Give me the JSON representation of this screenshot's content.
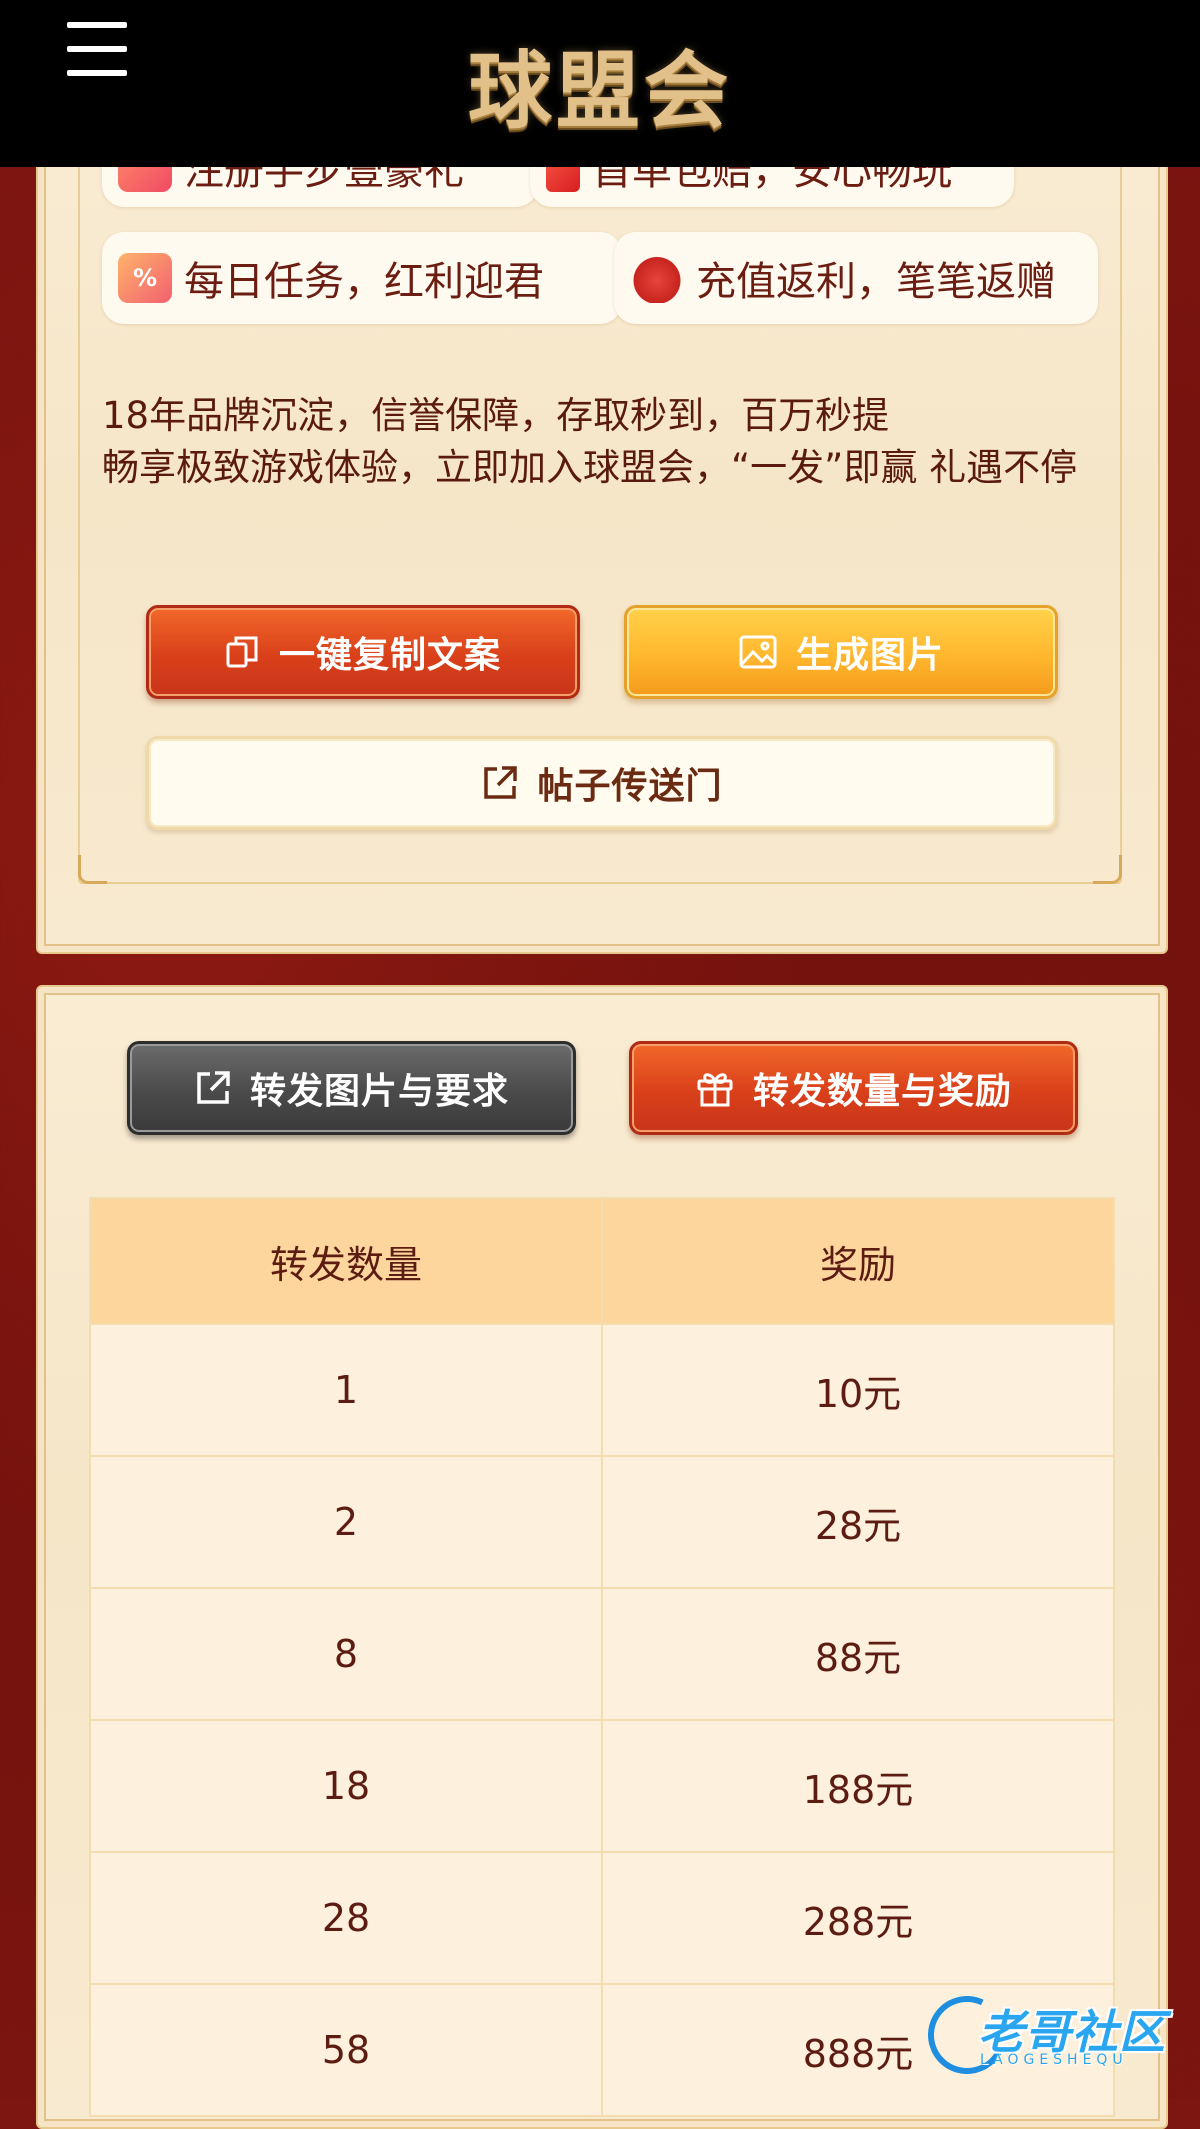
{
  "header": {
    "logo_text": "球盟会"
  },
  "features": {
    "chip1": "注册手步壹豪礼",
    "chip2": "首单包赔，安心畅玩",
    "chip3": "每日任务，红利迎君",
    "chip4": "充值返利，笔笔返赠"
  },
  "description": {
    "line1": "18年品牌沉淀，信誉保障，存取秒到，百万秒提",
    "line2": "畅享极致游戏体验，立即加入球盟会，“一发”即赢 礼遇不停"
  },
  "actions": {
    "copy_label": "一键复制文案",
    "image_label": "生成图片",
    "portal_label": "帖子传送门"
  },
  "tabs": {
    "requirements_label": "转发图片与要求",
    "rewards_label": "转发数量与奖励"
  },
  "reward_table": {
    "headers": [
      "转发数量",
      "奖励"
    ],
    "rows": [
      [
        "1",
        "10元"
      ],
      [
        "2",
        "28元"
      ],
      [
        "8",
        "88元"
      ],
      [
        "18",
        "188元"
      ],
      [
        "28",
        "288元"
      ],
      [
        "58",
        "888元"
      ]
    ]
  },
  "watermark": {
    "text": "老哥社区",
    "sub": "LAOGESHEQU"
  },
  "colors": {
    "primary_orange": "#d9401a",
    "gold": "#ffb72e",
    "text_dark_red": "#5c1c12",
    "table_header_bg": "#fdd69e",
    "table_cell_bg": "#fdf0dc"
  }
}
